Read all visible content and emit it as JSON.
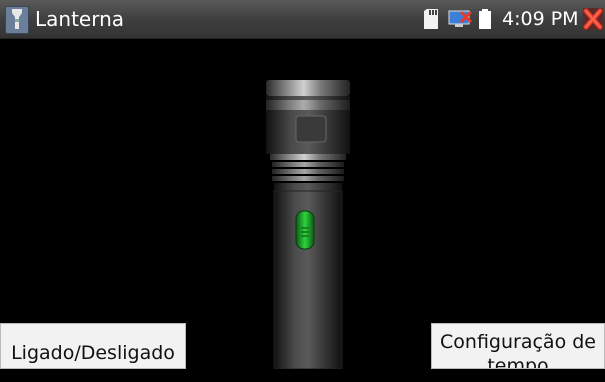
{
  "window": {
    "title": "Lanterna",
    "clock": "4:09 PM"
  },
  "icons": {
    "app": "flashlight-icon",
    "sd": "sd-card-icon",
    "network": "network-icon",
    "battery": "battery-icon",
    "close": "close-icon"
  },
  "buttons": {
    "power_label": "Ligado/Desligado",
    "time_label": "Configuração de tempo"
  },
  "colors": {
    "close": "#e63a2a",
    "switch": "#1faa2c"
  }
}
